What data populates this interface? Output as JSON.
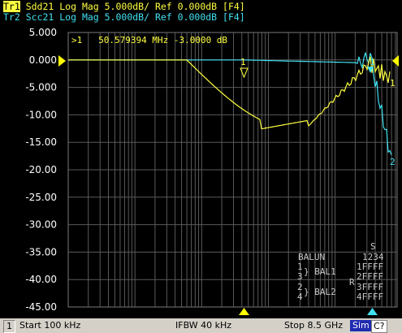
{
  "traces": [
    {
      "tag": "Tr1",
      "text": " Sdd21 Log Mag 5.000dB/ Ref 0.000dB [F4]",
      "color": "#ffff40"
    },
    {
      "tag": "Tr2",
      "text": " Scc21 Log Mag 5.000dB/ Ref 0.000dB [F4]",
      "color": "#40e0f0"
    }
  ],
  "y_labels": [
    "5.000",
    "0.000",
    "-5.000",
    "-10.00",
    "-15.00",
    "-20.00",
    "-25.00",
    "-30.00",
    "-35.00",
    "-40.00",
    "-45.00"
  ],
  "marker_readout": ">1   50.579394 MHz -3.0000 dB",
  "markers": {
    "tr1_main": "1",
    "tr1_end": "1",
    "tr2_main": "1",
    "tr2_end": "2"
  },
  "balun": {
    "title": "BALUN",
    "s_label": "S",
    "cols": "1234",
    "rows": [
      "1FFFF",
      "2FFFF",
      "3FFFF",
      "4FFFF"
    ],
    "r_label": "R",
    "bal1_ports": "1\n3",
    "bal1_label": "} BAL1",
    "bal2_ports": "2\n4",
    "bal2_label": "} BAL2"
  },
  "status": {
    "channel": "1",
    "start": "Start 100 kHz",
    "ifbw": "IFBW 40 kHz",
    "stop": "Stop 8.5 GHz",
    "sim": "Sim",
    "c2": "C?"
  },
  "colors": {
    "trace1": "#ffff40",
    "trace2": "#40e0f0",
    "grid": "#5a5a5a",
    "background": "#000000"
  }
}
